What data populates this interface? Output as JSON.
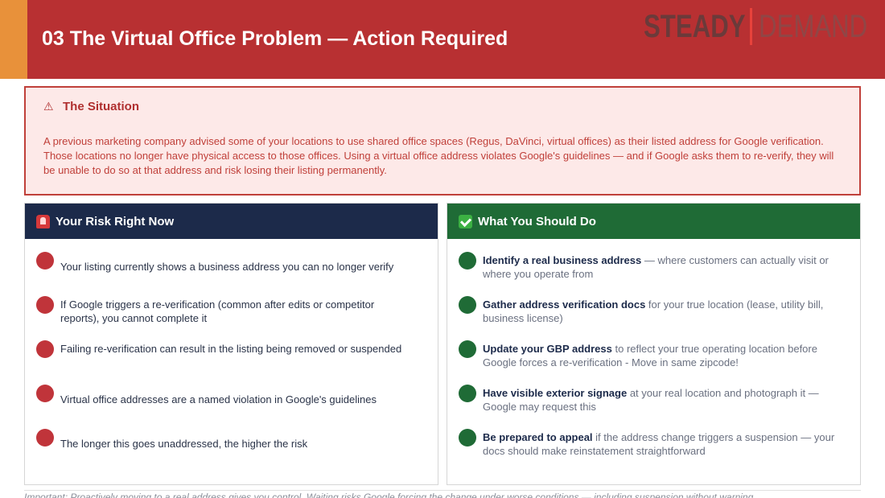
{
  "header": {
    "title": "03  The Virtual Office Problem — Action Required",
    "logo_left": "STEADY",
    "logo_right": "DEMAND",
    "colors": {
      "bar": "#b83032",
      "accent": "#e8913a"
    }
  },
  "situation": {
    "icon": "warning-icon",
    "title": "The Situation",
    "body": "A previous marketing company advised some of your locations to use shared office spaces (Regus, DaVinci, virtual offices) as their listed address for Google verification. Those locations no longer have physical access to those offices. Using a virtual office address violates Google's guidelines — and if Google asks them to re-verify, they will be unable to do so at that address and risk losing their listing permanently."
  },
  "risk": {
    "icon": "siren-icon",
    "title": "Your Risk Right Now",
    "items": [
      "Your listing currently shows a business address you can no longer verify",
      "If Google triggers a re-verification (common after edits or competitor reports), you cannot complete it",
      "Failing re-verification can result in the listing being removed or suspended",
      "Virtual office addresses are a named violation in Google's guidelines",
      "The longer this goes unaddressed, the higher the risk"
    ]
  },
  "actions": {
    "icon": "check-icon",
    "title": "What You Should Do",
    "items": [
      {
        "bold": "Identify a real business address",
        "rest": " — where customers can actually visit or where you operate from"
      },
      {
        "bold": "Gather address verification docs",
        "rest": " for your true location (lease, utility bill, business license)"
      },
      {
        "bold": "Update your GBP address",
        "rest": " to reflect your true operating location before Google forces a re-verification  - Move in same zipcode!"
      },
      {
        "bold": "Have visible exterior signage",
        "rest": " at your real location and photograph it — Google may request this"
      },
      {
        "bold": "Be prepared to appeal",
        "rest": " if the address change triggers a suspension — your docs should make reinstatement straightforward"
      }
    ]
  },
  "footnote": "Important: Proactively moving to a real address gives you control. Waiting risks Google forcing the change under worse conditions — including suspension without warning."
}
